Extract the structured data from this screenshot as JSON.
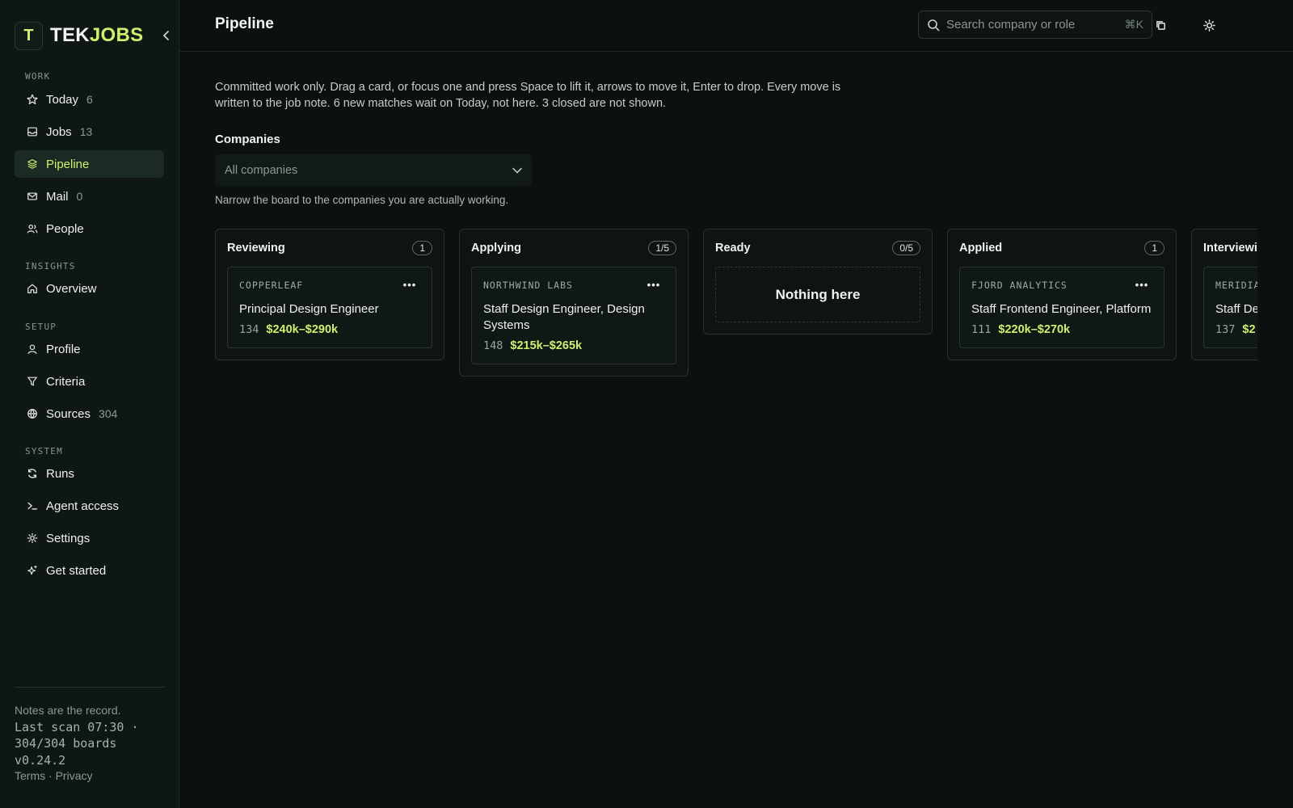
{
  "app": {
    "brand_mark": "T",
    "brand_part1": "TEK",
    "brand_part2": "JOBS"
  },
  "sidebar": {
    "sections": {
      "work": "WORK",
      "insights": "INSIGHTS",
      "setup": "SETUP",
      "system": "SYSTEM"
    },
    "items": {
      "today": {
        "label": "Today",
        "count": "6"
      },
      "jobs": {
        "label": "Jobs",
        "count": "13"
      },
      "pipeline": {
        "label": "Pipeline"
      },
      "mail": {
        "label": "Mail",
        "count": "0"
      },
      "people": {
        "label": "People"
      },
      "overview": {
        "label": "Overview"
      },
      "profile": {
        "label": "Profile"
      },
      "criteria": {
        "label": "Criteria"
      },
      "sources": {
        "label": "Sources",
        "count": "304"
      },
      "runs": {
        "label": "Runs"
      },
      "agent_access": {
        "label": "Agent access"
      },
      "settings": {
        "label": "Settings"
      },
      "get_started": {
        "label": "Get started"
      }
    },
    "footer": {
      "note": "Notes are the record.",
      "scan_line1": "Last scan 07:30 ·",
      "scan_line2": "304/304 boards",
      "version": "v0.24.2",
      "terms": "Terms",
      "separator": "·",
      "privacy": "Privacy"
    }
  },
  "header": {
    "title": "Pipeline",
    "search_placeholder": "Search company or role",
    "search_shortcut": "⌘K"
  },
  "main": {
    "description": "Committed work only. Drag a card, or focus one and press Space to lift it, arrows to move it, Enter to drop. Every move is written to the job note. 6 new matches wait on Today, not here. 3 closed are not shown.",
    "filter_label": "Companies",
    "filter_value": "All companies",
    "filter_hint": "Narrow the board to the companies you are actually working."
  },
  "columns": [
    {
      "title": "Reviewing",
      "count": "1",
      "cards": [
        {
          "company": "COPPERLEAF",
          "role": "Principal Design Engineer",
          "score": "134",
          "salary": "$240k–$290k"
        }
      ]
    },
    {
      "title": "Applying",
      "count": "1/5",
      "cards": [
        {
          "company": "NORTHWIND LABS",
          "role": "Staff Design Engineer, Design Systems",
          "score": "148",
          "salary": "$215k–$265k"
        }
      ]
    },
    {
      "title": "Ready",
      "count": "0/5",
      "empty": "Nothing here",
      "cards": []
    },
    {
      "title": "Applied",
      "count": "1",
      "cards": [
        {
          "company": "FJORD ANALYTICS",
          "role": "Staff Frontend Engineer, Platform",
          "score": "111",
          "salary": "$220k–$270k"
        }
      ]
    },
    {
      "title": "Interviewing",
      "count": "",
      "cards": [
        {
          "company": "MERIDIAN",
          "role": "Staff Design Engineer",
          "score": "137",
          "salary": "$2"
        }
      ]
    }
  ],
  "colors": {
    "accent": "#cdf16f",
    "background": "#0b110f",
    "sidebar": "#0f1714",
    "active_nav": "#1b2b24"
  }
}
